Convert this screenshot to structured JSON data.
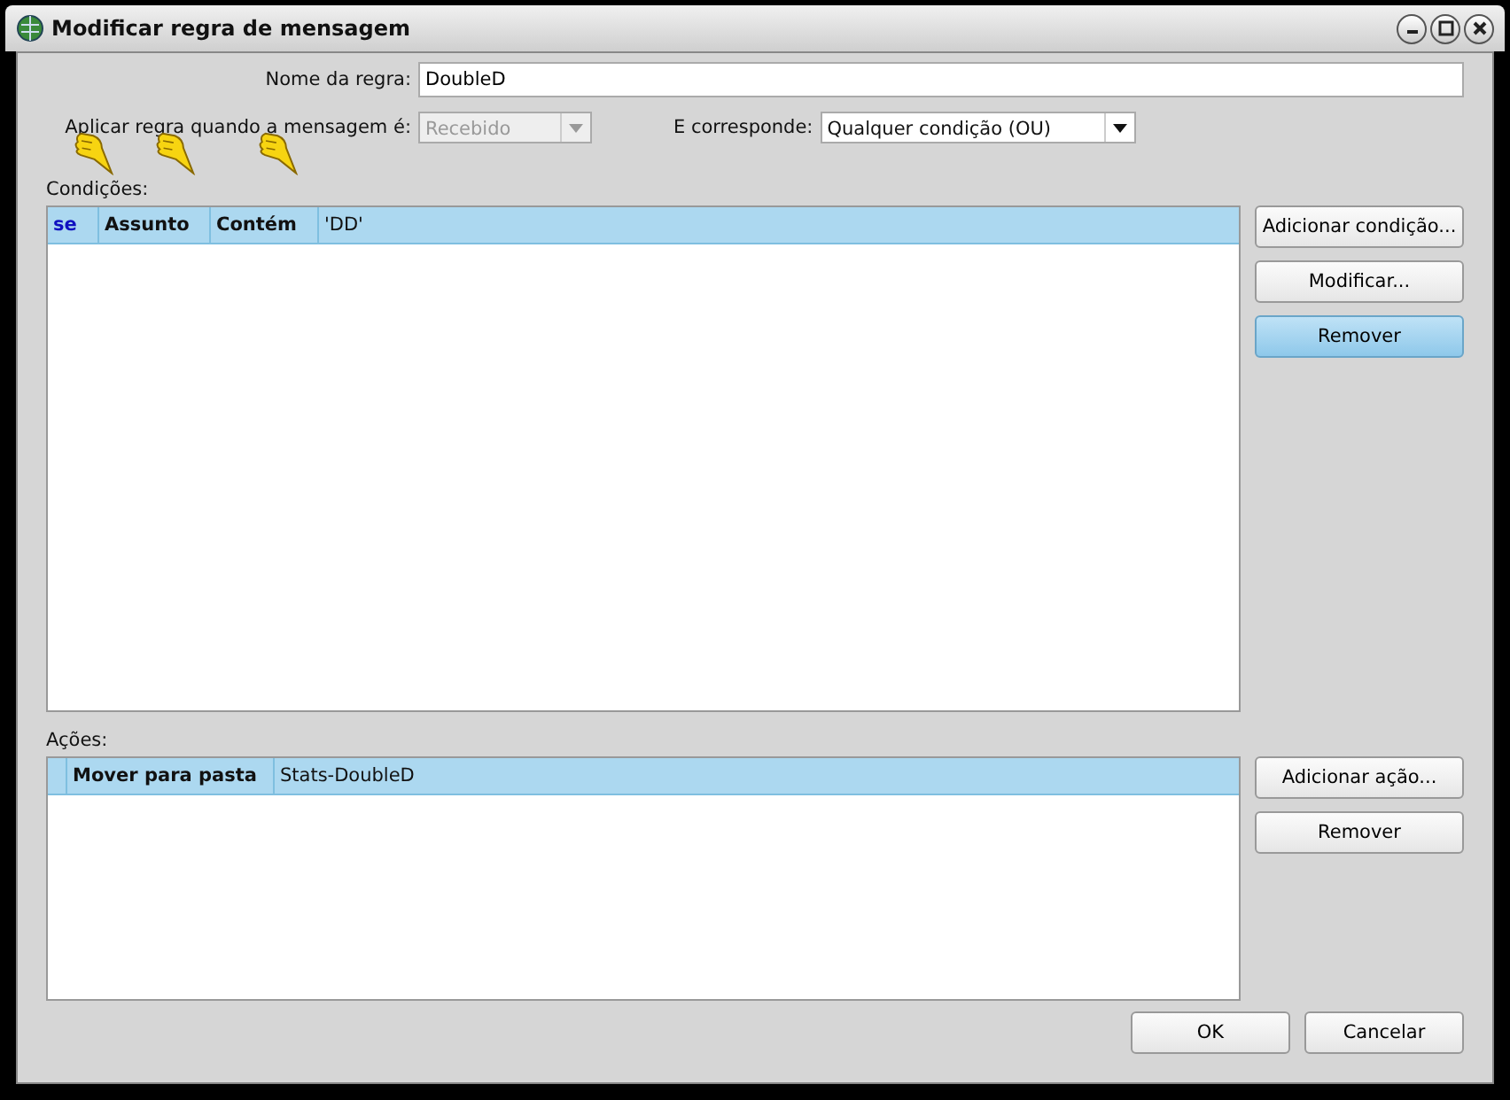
{
  "window": {
    "title": "Modificar regra de mensagem"
  },
  "rule_name": {
    "label": "Nome da regra:",
    "value": "DoubleD"
  },
  "apply_when": {
    "label": "Aplicar regra quando a mensagem é:",
    "value": "Recebido",
    "disabled": true
  },
  "match": {
    "label": "E corresponde:",
    "value": "Qualquer condição (OU)",
    "disabled": false
  },
  "conditions": {
    "label": "Condições:",
    "rows": [
      {
        "cells": [
          "se",
          "Assunto",
          "Contém",
          "'DD'"
        ],
        "selected": true
      }
    ],
    "buttons": [
      {
        "label": "Adicionar condição...",
        "highlighted": false
      },
      {
        "label": "Modificar...",
        "highlighted": false
      },
      {
        "label": "Remover",
        "highlighted": true
      }
    ]
  },
  "actions": {
    "label": "Ações:",
    "rows": [
      {
        "cells": [
          "",
          "Mover para pasta",
          "Stats-DoubleD"
        ],
        "selected": true
      }
    ],
    "buttons": [
      {
        "label": "Adicionar ação...",
        "highlighted": false
      },
      {
        "label": "Remover",
        "highlighted": false
      }
    ]
  },
  "buttons": [
    "OK",
    "Cancelar"
  ]
}
